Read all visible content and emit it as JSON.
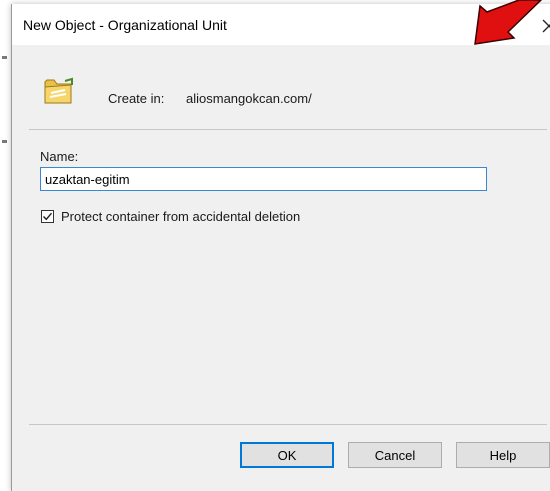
{
  "dialog": {
    "title": "New Object - Organizational Unit",
    "close_glyph": "✕"
  },
  "create_in": {
    "label": "Create in:",
    "value": "aliosmangokcan.com/"
  },
  "name_field": {
    "label": "Name:",
    "value": "uzaktan-egitim"
  },
  "protect_checkbox": {
    "label": "Protect container from accidental deletion",
    "checked": true
  },
  "buttons": {
    "ok": "OK",
    "cancel": "Cancel",
    "help": "Help"
  },
  "colors": {
    "annotation_arrow": "#e01010",
    "input_border": "#3c87d3",
    "default_button_border": "#0078d7"
  },
  "icons": {
    "folder": "organizational-unit-folder-icon",
    "close": "close-icon",
    "arrow": "annotation-arrow-icon"
  }
}
